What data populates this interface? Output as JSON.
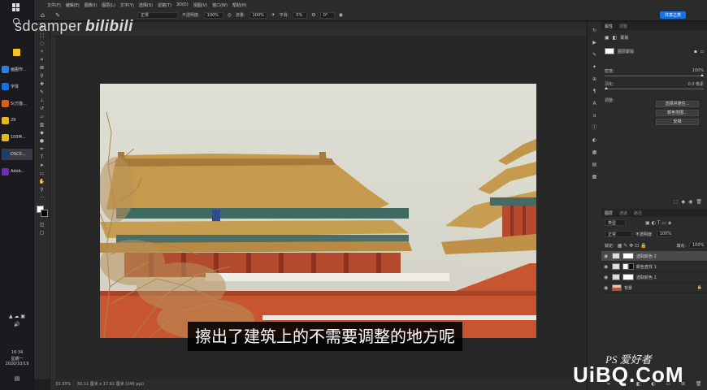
{
  "watermark": {
    "user": "sdcamper",
    "logo": "bilibili"
  },
  "subtitle": "擦出了建筑上的不需要调整的地方呢",
  "site": {
    "ps": "PS 爱好者",
    "domain": "UiBQ.CoM"
  },
  "taskbar": {
    "items": [
      {
        "label": "画图作...",
        "color": "#2f7de1",
        "active": false
      },
      {
        "label": "字体",
        "color": "#1b6fd6",
        "active": false
      },
      {
        "label": "5(万能...",
        "color": "#e05a1c",
        "active": false
      },
      {
        "label": "29",
        "color": "#e5b624",
        "active": false
      },
      {
        "label": "100M...",
        "color": "#e5b624",
        "active": false
      },
      {
        "label": "DSC0...",
        "color": "#1c3d6e",
        "active": true
      },
      {
        "label": "Adob...",
        "color": "#6d2fb1",
        "active": false
      }
    ],
    "time": "16:34",
    "weekday": "星期一",
    "date": "2020/10/19"
  },
  "options_bar": {
    "mode_value": "正常",
    "opacity_label": "不透明度:",
    "opacity_value": "100%",
    "flow_label": "流量:",
    "flow_value": "100%",
    "smooth_label": "平滑:",
    "smooth_value": "0%",
    "angle_value": "0°",
    "share_label": "共享之类"
  },
  "menubar": [
    "文件(F)",
    "编辑(E)",
    "图像(I)",
    "图层(L)",
    "文字(Y)",
    "选择(S)",
    "滤镜(T)",
    "3D(D)",
    "视图(V)",
    "窗口(W)",
    "帮助(H)"
  ],
  "status": {
    "zoom": "33.33%",
    "doc_info": "30.11 厘米 x 17.92 厘米 (240 ppi)"
  },
  "properties": {
    "tabs": [
      "属性",
      "调整"
    ],
    "mask_label": "蒙版",
    "pixel_mask_label": "图层蒙版",
    "density_label": "密度:",
    "density_value": "100%",
    "feather_label": "羽化:",
    "feather_value": "0.0 像素",
    "adjust_label": "调整:",
    "buttons": [
      "选择并遮住...",
      "颜色范围...",
      "反相"
    ]
  },
  "layers_panel": {
    "tabs": [
      "图层",
      "通道",
      "路径"
    ],
    "filter_value": "类型",
    "blend_mode": "正常",
    "opacity_label": "不透明度:",
    "opacity_value": "100%",
    "lock_label": "锁定:",
    "fill_label": "填充:",
    "fill_value": "100%",
    "layers": [
      {
        "name": "选取颜色 2",
        "selected": true
      },
      {
        "name": "颜色查找 1",
        "selected": false
      },
      {
        "name": "选取颜色 1",
        "selected": false
      },
      {
        "name": "背景",
        "selected": false
      }
    ]
  }
}
